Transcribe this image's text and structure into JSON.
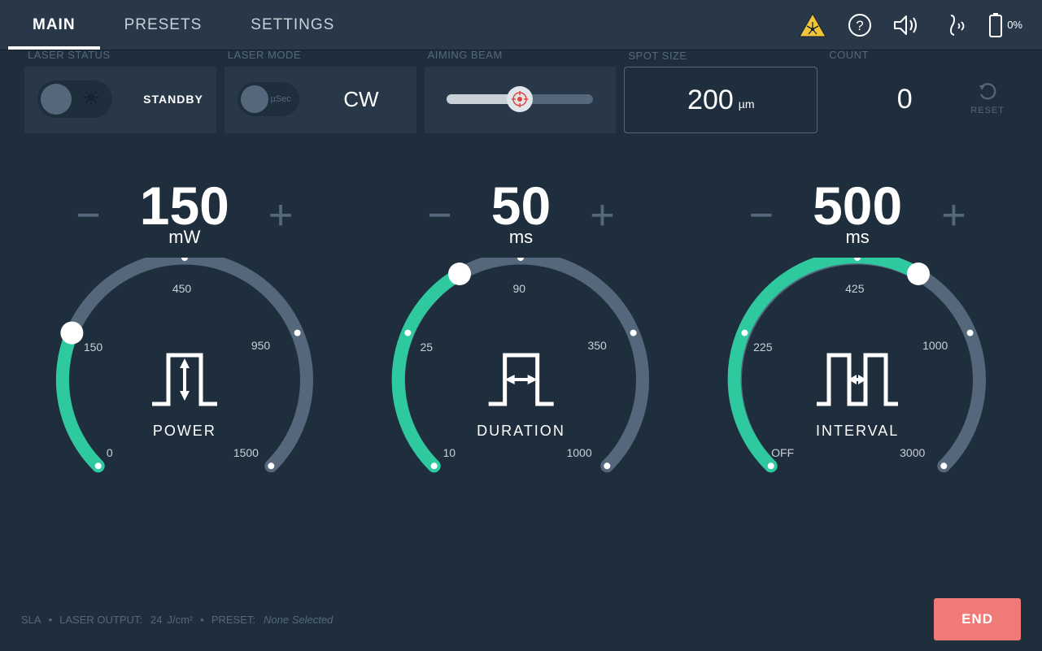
{
  "tabs": {
    "main": "MAIN",
    "presets": "PRESETS",
    "settings": "SETTINGS"
  },
  "battery_pct": "0%",
  "laser_status": {
    "label": "LASER STATUS",
    "state": "STANDBY"
  },
  "laser_mode": {
    "label": "LASER MODE",
    "toggle_text": "µSec",
    "value": "CW"
  },
  "aiming_beam": {
    "label": "AIMING BEAM"
  },
  "spot_size": {
    "label": "SPOT SIZE",
    "value": "200",
    "unit": "µm"
  },
  "count": {
    "label": "COUNT",
    "value": "0",
    "reset": "RESET"
  },
  "power": {
    "value": "150",
    "unit": "mW",
    "label": "POWER",
    "ticks": [
      "0",
      "150",
      "450",
      "950",
      "1500"
    ]
  },
  "duration": {
    "value": "50",
    "unit": "ms",
    "label": "DURATION",
    "ticks": [
      "10",
      "25",
      "90",
      "350",
      "1000"
    ]
  },
  "interval": {
    "value": "500",
    "unit": "ms",
    "label": "INTERVAL",
    "ticks": [
      "OFF",
      "225",
      "425",
      "1000",
      "3000"
    ]
  },
  "footer": {
    "sla": "SLA",
    "output_label": "LASER OUTPUT:",
    "output_value": "24",
    "output_unit": "J/cm²",
    "preset_label": "PRESET:",
    "preset_value": "None Selected",
    "end": "END"
  }
}
